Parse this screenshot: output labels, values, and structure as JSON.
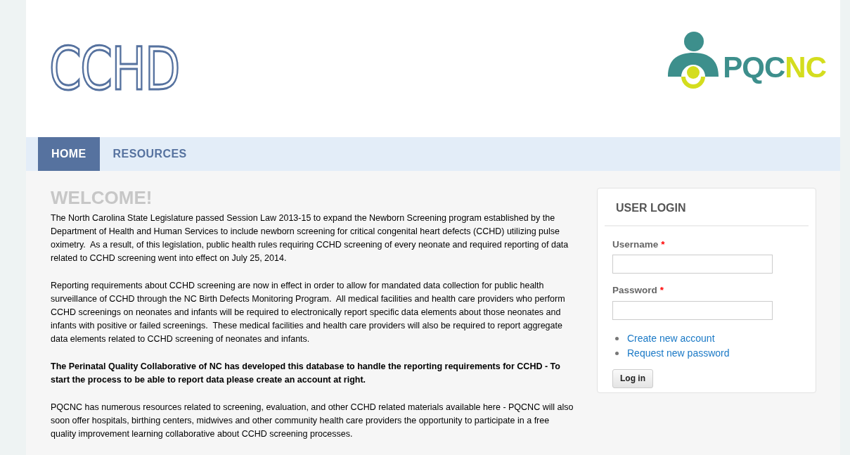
{
  "header": {
    "site_logo": "CCHD",
    "partner_logo": [
      {
        "text": "PQC",
        "color": "#3d8f8c"
      },
      {
        "text": "NC",
        "color": "#d4dd1e"
      }
    ]
  },
  "nav": {
    "tabs": [
      {
        "label": "HOME",
        "selected": true
      },
      {
        "label": "RESOURCES",
        "selected": false
      }
    ]
  },
  "main": {
    "title": "WELCOME!",
    "paragraphs": [
      {
        "text": "The North Carolina State Legislature passed Session Law 2013-15 to expand the Newborn Screening program established by the Department of Health and Human Services to include newborn screening for critical congenital heart defects (CCHD) utilizing pulse oximetry.  As a result, of this legislation, public health rules requiring CCHD screening of every neonate and required reporting of data related to CCHD screening went into effect on July 25, 2014.",
        "bold": false
      },
      {
        "text": "Reporting requirements about CCHD screening are now in effect in order to allow for mandated data collection for public health surveillance of CCHD through the NC Birth Defects Monitoring Program.  All medical facilities and health care providers who perform CCHD screenings on neonates and infants will be required to electronically report specific data elements about those neonates and infants with positive or failed screenings.  These medical facilities and health care providers will also be required to report aggregate data elements related to CCHD screening of neonates and infants.",
        "bold": false
      },
      {
        "text": "The Perinatal Quality Collaborative of NC has developed this database to handle the reporting requirements for CCHD - To start the process to be able to report data please create an account at right.",
        "bold": true
      },
      {
        "text": "PQCNC has numerous resources related to screening, evaluation, and other CCHD related materials available here - PQCNC will also soon offer hospitals, birthing centers, midwives and other community health care providers the opportunity to participate in a free quality improvement learning collaborative about CCHD screening processes.",
        "bold": false
      }
    ]
  },
  "login": {
    "title": "USER LOGIN",
    "fields": [
      {
        "label": "Username",
        "required_mark": "*"
      },
      {
        "label": "Password",
        "required_mark": "*"
      }
    ],
    "links": [
      "Create new account",
      "Request new password"
    ],
    "button": "Log in"
  }
}
